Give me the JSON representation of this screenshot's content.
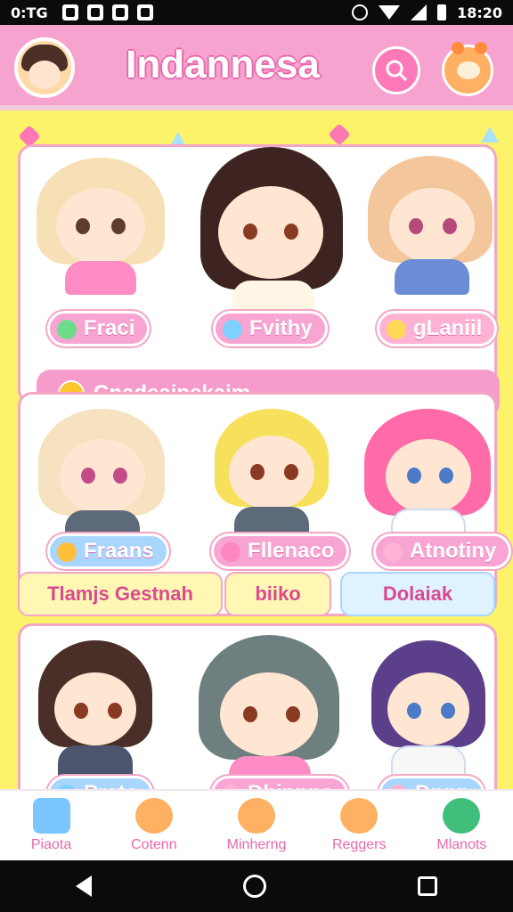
{
  "status_bar": {
    "time_left": "0:TG",
    "time_right": "18:20"
  },
  "header": {
    "app_title": "Indannesa"
  },
  "section1": {
    "pills": [
      "Fraci",
      "Fvithy",
      "gLaniil"
    ],
    "banner": "Cnadeajpekaim"
  },
  "section2": {
    "pills": [
      "Fraans",
      "Fllenaco",
      "Atnotiny"
    ],
    "tags": [
      "Tlamjs Gestnah",
      "biiko",
      "Dolaiak"
    ]
  },
  "section3": {
    "pills": [
      "Prato",
      "Dhinnne",
      "Dnnn"
    ]
  },
  "bottom_nav": {
    "items": [
      "Piaota",
      "Cotenn",
      "Minherng",
      "Reggers",
      "Mlanots"
    ]
  },
  "colors": {
    "accent_pink": "#f7a3d0",
    "title_outline": "#e86aac",
    "background_yellow": "#fdf36b",
    "section_border": "#f3a7c6"
  },
  "icons": {
    "search": "search-icon",
    "profile": "profile-icon",
    "home": "home-icon",
    "bear": "bear-icon",
    "notes": "notes-icon"
  }
}
